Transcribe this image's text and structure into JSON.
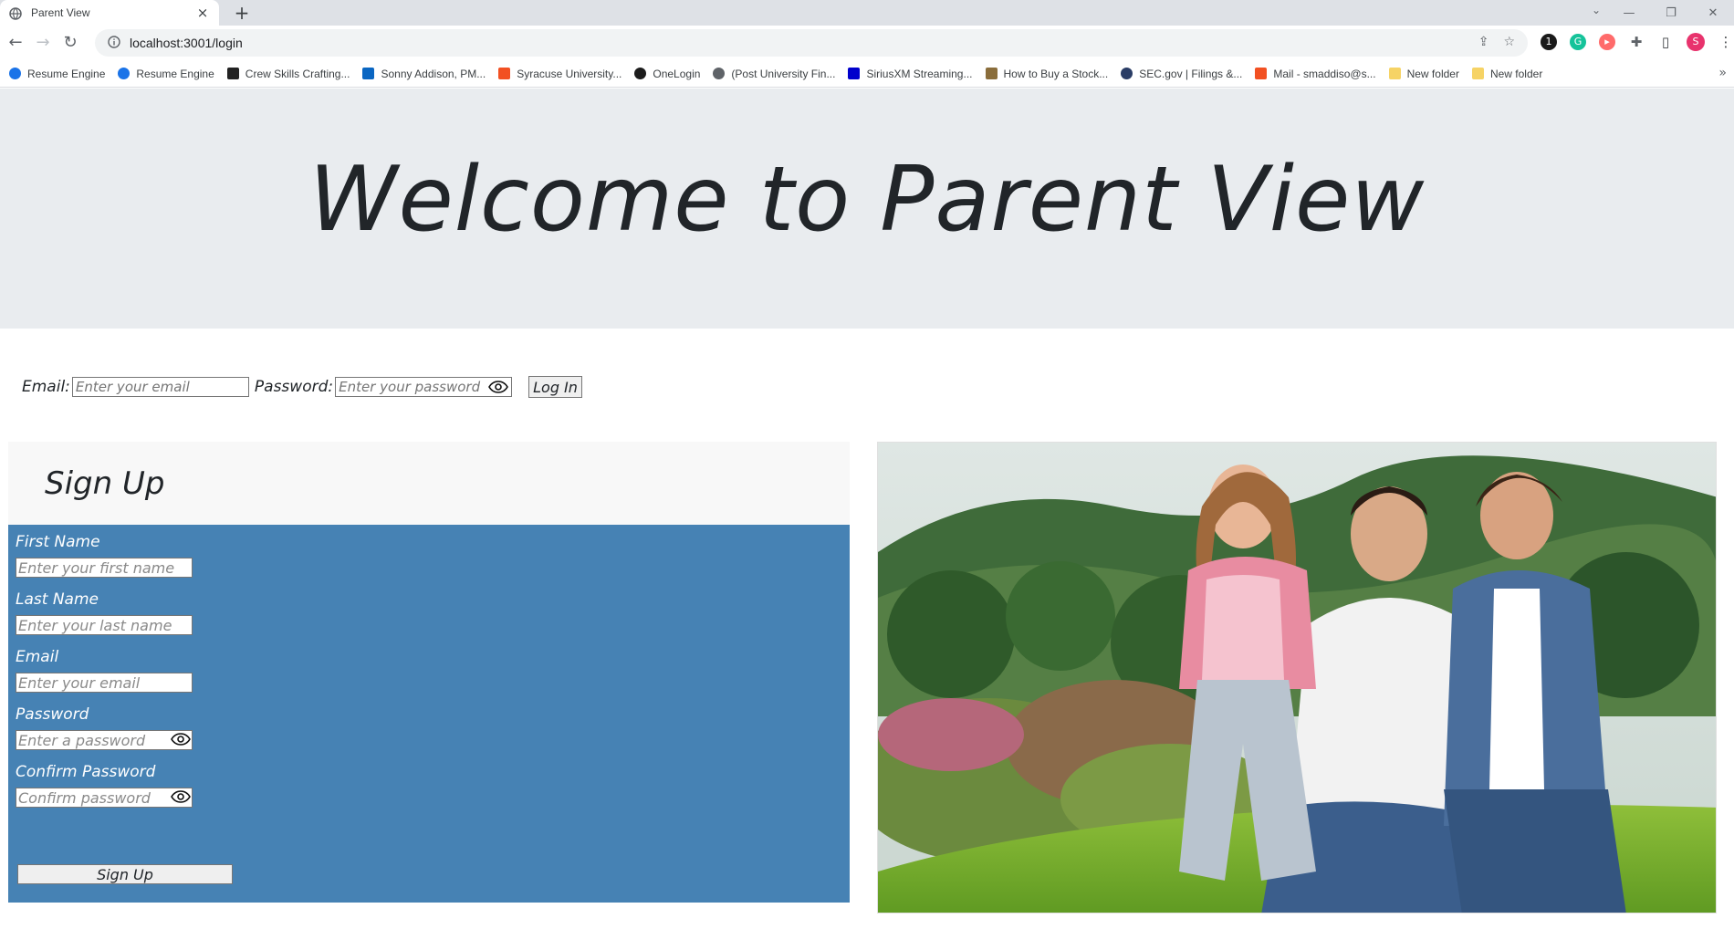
{
  "browser": {
    "tab_title": "Parent View",
    "url": "localhost:3001/login",
    "bookmarks": [
      {
        "label": "Resume Engine",
        "icon": "gear-icon",
        "color": "#1a73e8"
      },
      {
        "label": "Resume Engine",
        "icon": "gear-icon",
        "color": "#1a73e8"
      },
      {
        "label": "Crew Skills Crafting...",
        "icon": "triangle-icon",
        "color": "#222222"
      },
      {
        "label": "Sonny Addison, PM...",
        "icon": "linkedin-icon",
        "color": "#0a66c2"
      },
      {
        "label": "Syracuse University...",
        "icon": "microsoft-icon",
        "color": "#f25022"
      },
      {
        "label": "OneLogin",
        "icon": "onelogin-icon",
        "color": "#1c1c1c"
      },
      {
        "label": "(Post University Fin...",
        "icon": "globe-icon",
        "color": "#5f6368"
      },
      {
        "label": "SiriusXM Streaming...",
        "icon": "siriusxm-icon",
        "color": "#0000cc"
      },
      {
        "label": "How to Buy a Stock...",
        "icon": "stock-icon",
        "color": "#8a6d3b"
      },
      {
        "label": "SEC.gov | Filings &...",
        "icon": "sec-seal-icon",
        "color": "#2a3d66"
      },
      {
        "label": "Mail - smaddiso@s...",
        "icon": "microsoft-icon",
        "color": "#f25022"
      },
      {
        "label": "New folder",
        "icon": "folder-icon",
        "color": "#f6d365"
      },
      {
        "label": "New folder",
        "icon": "folder-icon",
        "color": "#f6d365"
      }
    ],
    "profile_initial": "S",
    "accent_colors": {
      "profile": "#e8336d",
      "grammarly": "#15c39a"
    }
  },
  "hero": {
    "title": "Welcome to Parent View"
  },
  "login": {
    "email_label": "Email:",
    "email_placeholder": "Enter your email",
    "password_label": "Password:",
    "password_placeholder": "Enter your password",
    "submit_label": "Log In"
  },
  "signup": {
    "heading": "Sign Up",
    "first_name_label": "First Name",
    "first_name_placeholder": "Enter your first name",
    "last_name_label": "Last Name",
    "last_name_placeholder": "Enter your last name",
    "email_label": "Email",
    "email_placeholder": "Enter your email",
    "password_label": "Password",
    "password_placeholder": "Enter a password",
    "confirm_label": "Confirm Password",
    "confirm_placeholder": "Confirm password",
    "submit_label": "Sign Up",
    "panel_color": "#4682b4"
  }
}
